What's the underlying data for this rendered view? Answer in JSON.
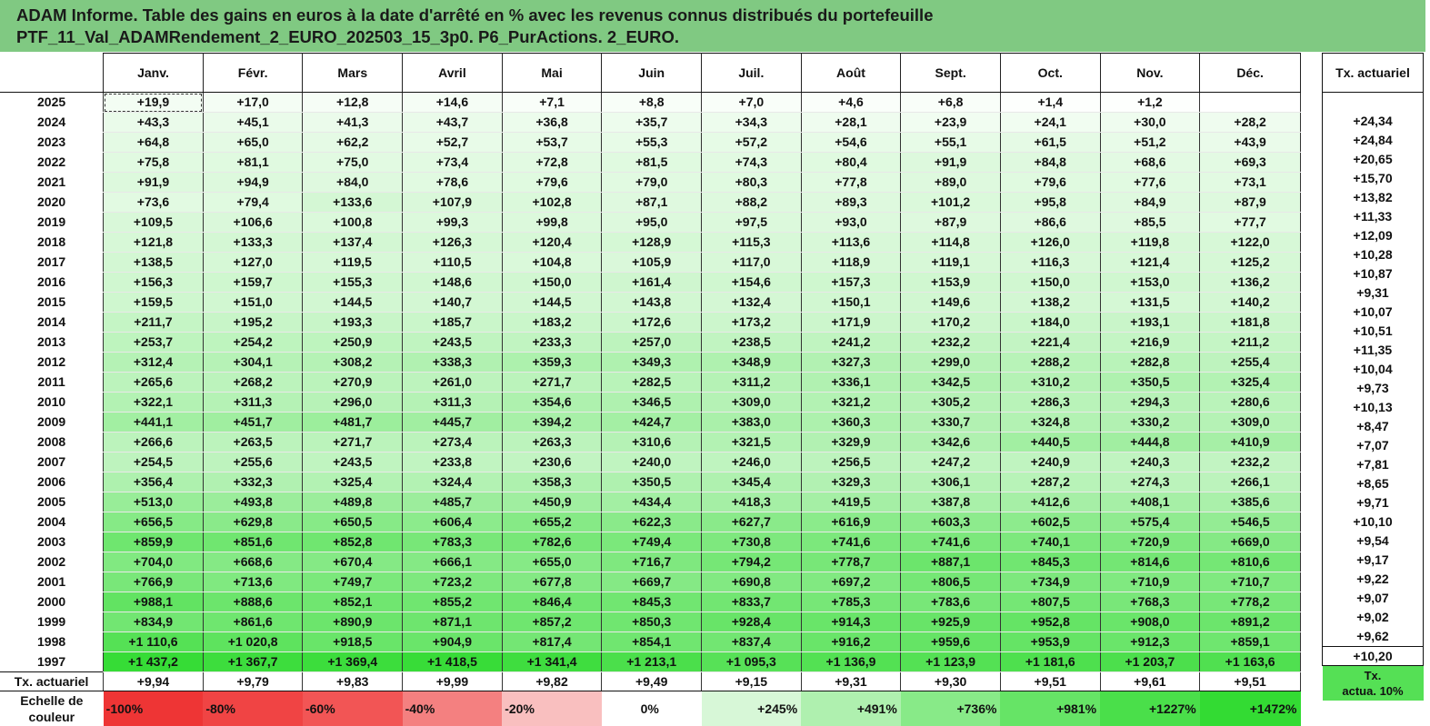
{
  "title": {
    "line1": "ADAM Informe. Table des gains en euros à la date d'arrêté en % avec les revenus connus distribués du portefeuille",
    "line2": "PTF_11_Val_ADAMRendement_2_EURO_202503_15_3p0. P6_PurActions. 2_EURO."
  },
  "months": [
    "Janv.",
    "Févr.",
    "Mars",
    "Avril",
    "Mai",
    "Juin",
    "Juil.",
    "Août",
    "Sept.",
    "Oct.",
    "Nov.",
    "Déc."
  ],
  "side_header": "Tx. actuariel",
  "rows": [
    {
      "year": "2025",
      "values": [
        "+19,9",
        "+17,0",
        "+12,8",
        "+14,6",
        "+7,1",
        "+8,8",
        "+7,0",
        "+4,6",
        "+6,8",
        "+1,4",
        "+1,2",
        ""
      ],
      "tx": ""
    },
    {
      "year": "2024",
      "values": [
        "+43,3",
        "+45,1",
        "+41,3",
        "+43,7",
        "+36,8",
        "+35,7",
        "+34,3",
        "+28,1",
        "+23,9",
        "+24,1",
        "+30,0",
        "+28,2"
      ],
      "tx": "+24,34"
    },
    {
      "year": "2023",
      "values": [
        "+64,8",
        "+65,0",
        "+62,2",
        "+52,7",
        "+53,7",
        "+55,3",
        "+57,2",
        "+54,6",
        "+55,1",
        "+61,5",
        "+51,2",
        "+43,9"
      ],
      "tx": "+24,84"
    },
    {
      "year": "2022",
      "values": [
        "+75,8",
        "+81,1",
        "+75,0",
        "+73,4",
        "+72,8",
        "+81,5",
        "+74,3",
        "+80,4",
        "+91,9",
        "+84,8",
        "+68,6",
        "+69,3"
      ],
      "tx": "+20,65"
    },
    {
      "year": "2021",
      "values": [
        "+91,9",
        "+94,9",
        "+84,0",
        "+78,6",
        "+79,6",
        "+79,0",
        "+80,3",
        "+77,8",
        "+89,0",
        "+79,6",
        "+77,6",
        "+73,1"
      ],
      "tx": "+15,70"
    },
    {
      "year": "2020",
      "values": [
        "+73,6",
        "+79,4",
        "+133,6",
        "+107,9",
        "+102,8",
        "+87,1",
        "+88,2",
        "+89,3",
        "+101,2",
        "+95,8",
        "+84,9",
        "+87,9"
      ],
      "tx": "+13,82"
    },
    {
      "year": "2019",
      "values": [
        "+109,5",
        "+106,6",
        "+100,8",
        "+99,3",
        "+99,8",
        "+95,0",
        "+97,5",
        "+93,0",
        "+87,9",
        "+86,6",
        "+85,5",
        "+77,7"
      ],
      "tx": "+11,33"
    },
    {
      "year": "2018",
      "values": [
        "+121,8",
        "+133,3",
        "+137,4",
        "+126,3",
        "+120,4",
        "+128,9",
        "+115,3",
        "+113,6",
        "+114,8",
        "+126,0",
        "+119,8",
        "+122,0"
      ],
      "tx": "+12,09"
    },
    {
      "year": "2017",
      "values": [
        "+138,5",
        "+127,0",
        "+119,5",
        "+110,5",
        "+104,8",
        "+105,9",
        "+117,0",
        "+118,9",
        "+119,1",
        "+116,3",
        "+121,4",
        "+125,2"
      ],
      "tx": "+10,28"
    },
    {
      "year": "2016",
      "values": [
        "+156,3",
        "+159,7",
        "+155,3",
        "+148,6",
        "+150,0",
        "+161,4",
        "+154,6",
        "+157,3",
        "+153,9",
        "+150,0",
        "+153,0",
        "+136,2"
      ],
      "tx": "+10,87"
    },
    {
      "year": "2015",
      "values": [
        "+159,5",
        "+151,0",
        "+144,5",
        "+140,7",
        "+144,5",
        "+143,8",
        "+132,4",
        "+150,1",
        "+149,6",
        "+138,2",
        "+131,5",
        "+140,2"
      ],
      "tx": "+9,31"
    },
    {
      "year": "2014",
      "values": [
        "+211,7",
        "+195,2",
        "+193,3",
        "+185,7",
        "+183,2",
        "+172,6",
        "+173,2",
        "+171,9",
        "+170,2",
        "+184,0",
        "+193,1",
        "+181,8"
      ],
      "tx": "+10,07"
    },
    {
      "year": "2013",
      "values": [
        "+253,7",
        "+254,2",
        "+250,9",
        "+243,5",
        "+233,3",
        "+257,0",
        "+238,5",
        "+241,2",
        "+232,2",
        "+221,4",
        "+216,9",
        "+211,2"
      ],
      "tx": "+10,51"
    },
    {
      "year": "2012",
      "values": [
        "+312,4",
        "+304,1",
        "+308,2",
        "+338,3",
        "+359,3",
        "+349,3",
        "+348,9",
        "+327,3",
        "+299,0",
        "+288,2",
        "+282,8",
        "+255,4"
      ],
      "tx": "+11,35"
    },
    {
      "year": "2011",
      "values": [
        "+265,6",
        "+268,2",
        "+270,9",
        "+261,0",
        "+271,7",
        "+282,5",
        "+311,2",
        "+336,1",
        "+342,5",
        "+310,2",
        "+350,5",
        "+325,4"
      ],
      "tx": "+10,04"
    },
    {
      "year": "2010",
      "values": [
        "+322,1",
        "+311,3",
        "+296,0",
        "+311,3",
        "+354,6",
        "+346,5",
        "+309,0",
        "+321,2",
        "+305,2",
        "+286,3",
        "+294,3",
        "+280,6"
      ],
      "tx": "+9,73"
    },
    {
      "year": "2009",
      "values": [
        "+441,1",
        "+451,7",
        "+481,7",
        "+445,7",
        "+394,2",
        "+424,7",
        "+383,0",
        "+360,3",
        "+330,7",
        "+324,8",
        "+330,2",
        "+309,0"
      ],
      "tx": "+10,13"
    },
    {
      "year": "2008",
      "values": [
        "+266,6",
        "+263,5",
        "+271,7",
        "+273,4",
        "+263,3",
        "+310,6",
        "+321,5",
        "+329,9",
        "+342,6",
        "+440,5",
        "+444,8",
        "+410,9"
      ],
      "tx": "+8,47"
    },
    {
      "year": "2007",
      "values": [
        "+254,5",
        "+255,6",
        "+243,5",
        "+233,8",
        "+230,6",
        "+240,0",
        "+246,0",
        "+256,5",
        "+247,2",
        "+240,9",
        "+240,3",
        "+232,2"
      ],
      "tx": "+7,07"
    },
    {
      "year": "2006",
      "values": [
        "+356,4",
        "+332,3",
        "+325,4",
        "+324,4",
        "+358,3",
        "+350,5",
        "+345,4",
        "+329,3",
        "+306,1",
        "+287,2",
        "+274,3",
        "+266,1"
      ],
      "tx": "+7,81"
    },
    {
      "year": "2005",
      "values": [
        "+513,0",
        "+493,8",
        "+489,8",
        "+485,7",
        "+450,9",
        "+434,4",
        "+418,3",
        "+419,5",
        "+387,8",
        "+412,6",
        "+408,1",
        "+385,6"
      ],
      "tx": "+8,65"
    },
    {
      "year": "2004",
      "values": [
        "+656,5",
        "+629,8",
        "+650,5",
        "+606,4",
        "+655,2",
        "+622,3",
        "+627,7",
        "+616,9",
        "+603,3",
        "+602,5",
        "+575,4",
        "+546,5"
      ],
      "tx": "+9,71"
    },
    {
      "year": "2003",
      "values": [
        "+859,9",
        "+851,6",
        "+852,8",
        "+783,3",
        "+782,6",
        "+749,4",
        "+730,8",
        "+741,6",
        "+741,6",
        "+740,1",
        "+720,9",
        "+669,0"
      ],
      "tx": "+10,10"
    },
    {
      "year": "2002",
      "values": [
        "+704,0",
        "+668,6",
        "+670,4",
        "+666,1",
        "+655,0",
        "+716,7",
        "+794,2",
        "+778,7",
        "+887,1",
        "+845,3",
        "+814,6",
        "+810,6"
      ],
      "tx": "+9,54"
    },
    {
      "year": "2001",
      "values": [
        "+766,9",
        "+713,6",
        "+749,7",
        "+723,2",
        "+677,8",
        "+669,7",
        "+690,8",
        "+697,2",
        "+806,5",
        "+734,9",
        "+710,9",
        "+710,7"
      ],
      "tx": "+9,17"
    },
    {
      "year": "2000",
      "values": [
        "+988,1",
        "+888,6",
        "+852,1",
        "+855,2",
        "+846,4",
        "+845,3",
        "+833,7",
        "+785,3",
        "+783,6",
        "+807,5",
        "+768,3",
        "+778,2"
      ],
      "tx": "+9,22"
    },
    {
      "year": "1999",
      "values": [
        "+834,9",
        "+861,6",
        "+890,9",
        "+871,1",
        "+857,2",
        "+850,3",
        "+928,4",
        "+914,3",
        "+925,9",
        "+952,8",
        "+908,0",
        "+891,2"
      ],
      "tx": "+9,07"
    },
    {
      "year": "1998",
      "values": [
        "+1 110,6",
        "+1 020,8",
        "+918,5",
        "+904,9",
        "+817,4",
        "+854,1",
        "+837,4",
        "+916,2",
        "+959,6",
        "+953,9",
        "+912,3",
        "+859,1"
      ],
      "tx": "+9,02"
    },
    {
      "year": "1997",
      "values": [
        "+1 437,2",
        "+1 367,7",
        "+1 369,4",
        "+1 418,5",
        "+1 341,4",
        "+1 213,1",
        "+1 095,3",
        "+1 136,9",
        "+1 123,9",
        "+1 181,6",
        "+1 203,7",
        "+1 163,6"
      ],
      "tx": "+9,62"
    }
  ],
  "actuariel_row": {
    "label": "Tx. actuariel",
    "values": [
      "+9,94",
      "+9,79",
      "+9,83",
      "+9,99",
      "+9,82",
      "+9,49",
      "+9,15",
      "+9,31",
      "+9,30",
      "+9,51",
      "+9,61",
      "+9,51"
    ],
    "tx": "+10,20"
  },
  "scale": {
    "label_line1": "Echelle de",
    "label_line2": "couleur",
    "swatches": [
      {
        "text": "-100%",
        "color": "#EE3535"
      },
      {
        "text": "-80%",
        "color": "#F04444"
      },
      {
        "text": "-60%",
        "color": "#F25555"
      },
      {
        "text": "-40%",
        "color": "#F48080"
      },
      {
        "text": "-20%",
        "color": "#F9BFBF"
      },
      {
        "text": "0%",
        "color": "#FFFFFF"
      },
      {
        "text": "+245%",
        "color": "#D7F7D7"
      },
      {
        "text": "+491%",
        "color": "#AFF0AF"
      },
      {
        "text": "+736%",
        "color": "#88EA88"
      },
      {
        "text": "+981%",
        "color": "#66E466"
      },
      {
        "text": "+1227%",
        "color": "#4ADF4A"
      },
      {
        "text": "+1472%",
        "color": "#33DB33"
      }
    ],
    "side_line1": "Tx.",
    "side_line2": "actua. 10%"
  },
  "colors": {
    "title_bg": "#80C982",
    "scale_max": "#33DB33",
    "scale_min": "#EE3535"
  }
}
